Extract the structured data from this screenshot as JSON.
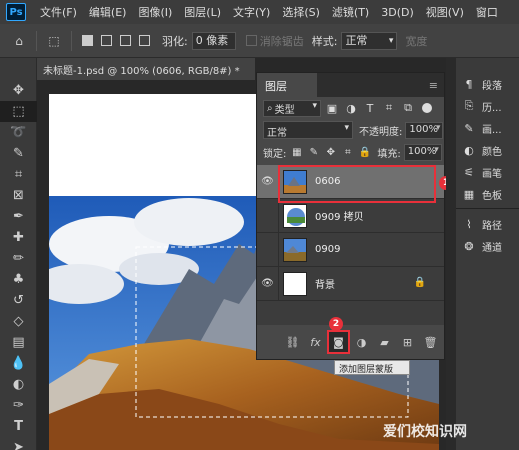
{
  "app": {
    "logo": "Ps"
  },
  "menu": [
    "文件(F)",
    "编辑(E)",
    "图像(I)",
    "图层(L)",
    "文字(Y)",
    "选择(S)",
    "滤镜(T)",
    "3D(D)",
    "视图(V)",
    "窗口"
  ],
  "options": {
    "feather_label": "羽化:",
    "feather_value": "0 像素",
    "antialias_label": "消除锯齿",
    "style_label": "样式:",
    "style_value": "正常",
    "width_label": "宽度"
  },
  "document": {
    "tab_title": "未标题-1.psd @ 100% (0606, RGB/8#) *"
  },
  "layers_panel": {
    "title": "图层",
    "filter_kind": "类型",
    "blend_mode": "正常",
    "opacity_label": "不透明度:",
    "opacity_value": "100%",
    "lock_label": "锁定:",
    "fill_label": "填充:",
    "fill_value": "100%",
    "layers": [
      {
        "name": "0606",
        "visible": true,
        "selected": true
      },
      {
        "name": "0909 拷贝",
        "visible": false,
        "selected": false
      },
      {
        "name": "0909",
        "visible": false,
        "selected": false
      },
      {
        "name": "背景",
        "visible": true,
        "selected": false,
        "locked": true
      }
    ],
    "footer_fx": "fx",
    "tooltip": "添加图层蒙版"
  },
  "annotations": {
    "badge1": "1",
    "badge2": "2",
    "accent": "#e8303a"
  },
  "right_panel": {
    "items": [
      "段落",
      "历...",
      "画...",
      "颜色",
      "画笔",
      "色板",
      "路径",
      "通道"
    ]
  },
  "watermark": "爱们校知识网"
}
